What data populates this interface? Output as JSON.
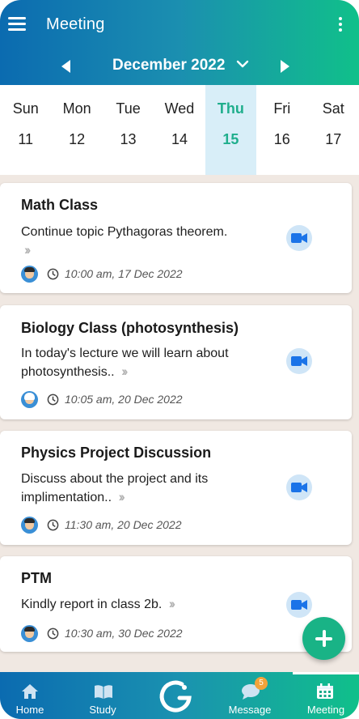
{
  "header": {
    "title": "Meeting",
    "month_label": "December 2022"
  },
  "week": {
    "days": [
      {
        "name": "Sun",
        "num": "11"
      },
      {
        "name": "Mon",
        "num": "12"
      },
      {
        "name": "Tue",
        "num": "13"
      },
      {
        "name": "Wed",
        "num": "14"
      },
      {
        "name": "Thu",
        "num": "15"
      },
      {
        "name": "Fri",
        "num": "16"
      },
      {
        "name": "Sat",
        "num": "17"
      }
    ],
    "selected_day": "Thu"
  },
  "meetings": [
    {
      "title": "Math Class",
      "description": "Continue topic Pythagoras theorem.",
      "time": "10:00 am, 17 Dec 2022"
    },
    {
      "title": "Biology Class (photosynthesis)",
      "description": "In today's lecture we will learn about photosynthesis..",
      "time": "10:05 am, 20 Dec 2022"
    },
    {
      "title": "Physics Project Discussion",
      "description": "Discuss about the project and its implimentation..",
      "time": "11:30 am, 20 Dec 2022"
    },
    {
      "title": "PTM",
      "description": "Kindly report in class 2b.",
      "time": "10:30 am, 30 Dec 2022"
    }
  ],
  "bottom_nav": {
    "home": "Home",
    "study": "Study",
    "message": "Message",
    "message_badge": "5",
    "meeting": "Meeting"
  },
  "icons": {
    "menu": "hamburger-icon",
    "more": "kebab-menu-icon",
    "prev": "arrow-left-icon",
    "next": "arrow-right-icon",
    "video": "video-camera-icon",
    "clock": "clock-icon",
    "add": "plus-icon"
  },
  "colors": {
    "accent": "#1fae8c",
    "header_start": "#0b6bb0",
    "header_end": "#10c08a",
    "fab": "#19b386",
    "selected_day_bg": "#d8eef8"
  }
}
